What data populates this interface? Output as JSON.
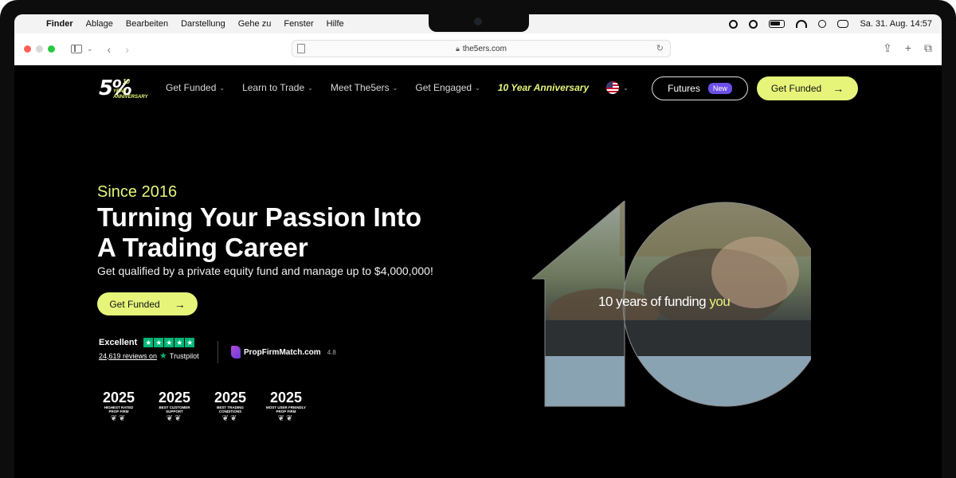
{
  "menubar": {
    "app": "Finder",
    "items": [
      "Ablage",
      "Bearbeiten",
      "Darstellung",
      "Gehe zu",
      "Fenster",
      "Hilfe"
    ],
    "clock": "Sa. 31. Aug.  14:57"
  },
  "browser": {
    "url": "the5ers.com"
  },
  "site": {
    "logo": {
      "five": "5%",
      "ten": "10",
      "year": "YEAR",
      "anniv": "ANNIVERSARY"
    },
    "nav": [
      "Get Funded",
      "Learn to Trade",
      "Meet The5ers",
      "Get Engaged"
    ],
    "nav_anniversary": "10 Year Anniversary",
    "futures_label": "Futures",
    "futures_badge": "New",
    "cta_top": "Get Funded",
    "hero": {
      "since": "Since 2016",
      "headline_1": "Turning Your Passion Into",
      "headline_2": "A Trading Career",
      "subline": "Get qualified by a private equity fund and manage up to $4,000,000!",
      "cta": "Get Funded",
      "graphic_caption": "10 years of funding",
      "graphic_caption_highlight": "you"
    },
    "trustpilot": {
      "rating_word": "Excellent",
      "reviews": "24,619 reviews on",
      "brand": "Trustpilot"
    },
    "propfirmmatch": {
      "name": "PropFirmMatch.com",
      "rating": "4.8"
    },
    "awards": [
      {
        "year": "2025",
        "title": "HIGHEST RATED\nPROP FIRM"
      },
      {
        "year": "2025",
        "title": "BEST CUSTOMER\nSUPPORT"
      },
      {
        "year": "2025",
        "title": "BEST TRADING\nCONDITIONS"
      },
      {
        "year": "2025",
        "title": "MOST USER FRIENDLY\nPROP FIRM"
      }
    ]
  },
  "colors": {
    "accent": "#e6f57a",
    "background": "#000000",
    "badge": "#6d4ee6",
    "trustpilot": "#00b67a"
  }
}
